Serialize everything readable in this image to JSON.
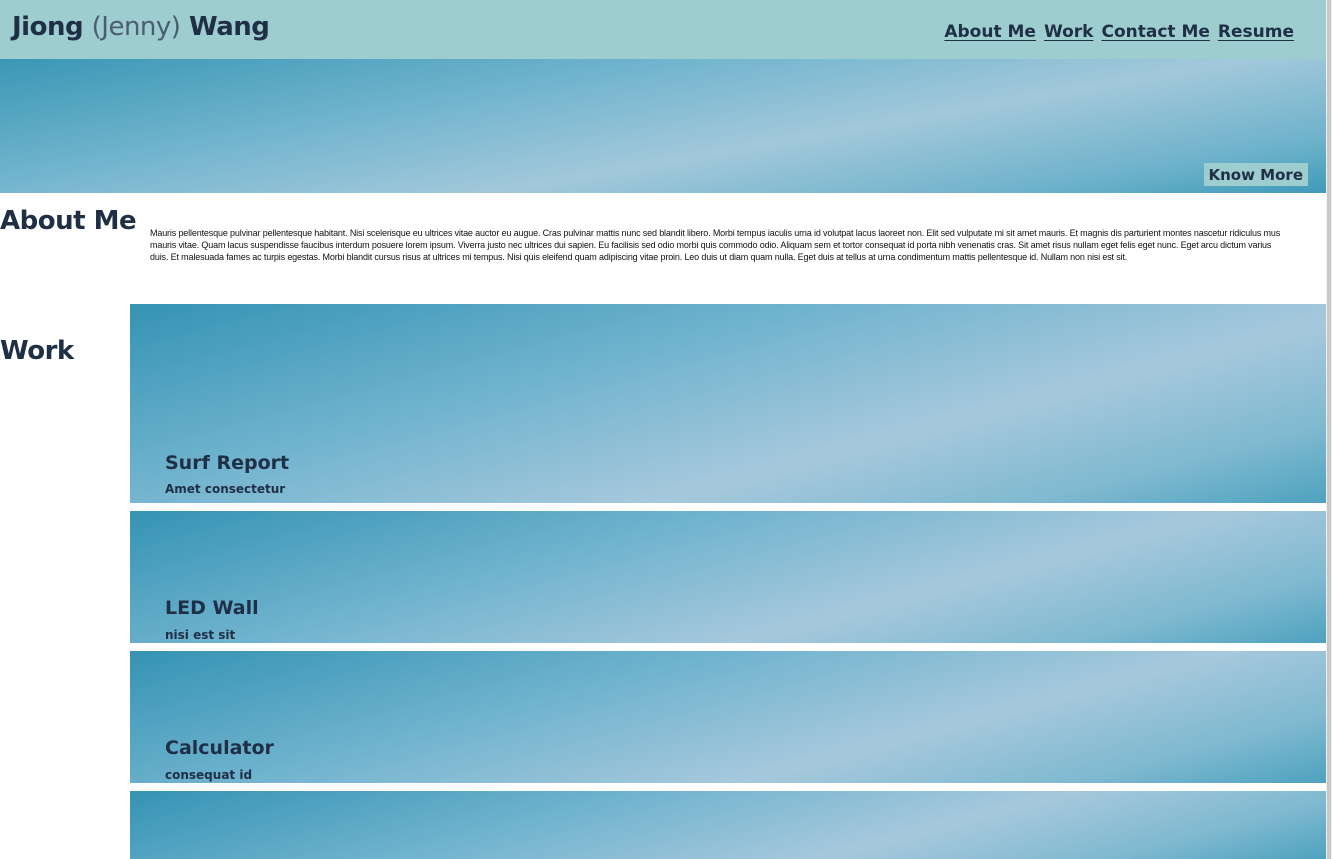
{
  "header": {
    "name_first": "Jiong",
    "name_nick": "(Jenny)",
    "name_last": "Wang",
    "nav": [
      "About Me",
      "Work",
      "Contact Me",
      "Resume"
    ]
  },
  "hero": {
    "button_label": "Know More"
  },
  "about": {
    "heading": "About Me",
    "text": "Mauris pellentesque pulvinar pellentesque habitant. Nisi scelerisque eu ultrices vitae auctor eu augue. Cras pulvinar mattis nunc sed blandit libero. Morbi tempus iaculis urna id volutpat lacus laoreet non. Elit sed vulputate mi sit amet mauris. Et magnis dis parturient montes nascetur ridiculus mus mauris vitae. Quam lacus suspendisse faucibus interdum posuere lorem ipsum. Viverra justo nec ultrices dui sapien. Eu facilisis sed odio morbi quis commodo odio. Aliquam sem et tortor consequat id porta nibh venenatis cras. Sit amet risus nullam eget felis eget nunc. Eget arcu dictum varius duis. Et malesuada fames ac turpis egestas. Morbi blandit cursus risus at ultrices mi tempus. Nisi quis eleifend quam adipiscing vitae proin. Leo duis ut diam quam nulla. Eget duis at tellus at urna condimentum mattis pellentesque id. Nullam non nisi est sit."
  },
  "work": {
    "heading": "Work",
    "projects": [
      {
        "title": "Surf Report",
        "subtitle": "Amet consectetur"
      },
      {
        "title": "LED Wall",
        "subtitle": "nisi est sit"
      },
      {
        "title": "Calculator",
        "subtitle": "consequat id"
      },
      {
        "title": "",
        "subtitle": ""
      }
    ]
  },
  "colors": {
    "header_bg": "#9dcdcf",
    "text_dark": "#1f2f45",
    "gradient_blue": "#3a97b5"
  }
}
